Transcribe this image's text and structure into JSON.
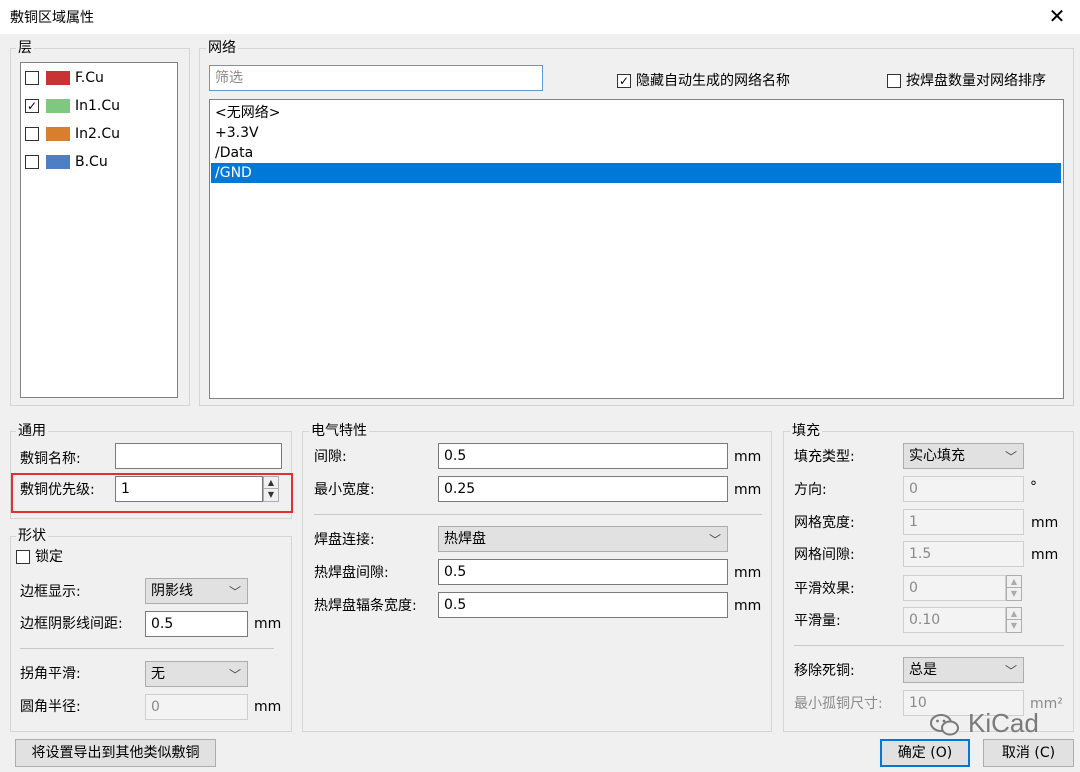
{
  "window": {
    "title": "敷铜区域属性",
    "close_glyph": "✕"
  },
  "layers": {
    "group_label": "层",
    "items": [
      {
        "name": "F.Cu",
        "checked": false,
        "color": "#c83434"
      },
      {
        "name": "In1.Cu",
        "checked": true,
        "color": "#7fc87f"
      },
      {
        "name": "In2.Cu",
        "checked": false,
        "color": "#d87f2e"
      },
      {
        "name": "B.Cu",
        "checked": false,
        "color": "#4d7fc4"
      }
    ]
  },
  "nets": {
    "group_label": "网络",
    "filter_placeholder": "筛选",
    "hide_auto_label": "隐藏自动生成的网络名称",
    "hide_auto_checked": true,
    "sort_by_pads_label": "按焊盘数量对网络排序",
    "sort_by_pads_checked": false,
    "items": [
      "<无网络>",
      "+3.3V",
      "/Data",
      "/GND"
    ],
    "selected_index": 3
  },
  "general": {
    "group_label": "通用",
    "name_label": "敷铜名称:",
    "name_value": "",
    "priority_label": "敷铜优先级:",
    "priority_value": "1"
  },
  "shape": {
    "group_label": "形状",
    "lock_label": "锁定",
    "lock_checked": false,
    "outline_display_label": "边框显示:",
    "outline_display_value": "阴影线",
    "hatch_pitch_label": "边框阴影线间距:",
    "hatch_pitch_value": "0.5",
    "hatch_pitch_unit": "mm",
    "corner_smoothing_label": "拐角平滑:",
    "corner_smoothing_value": "无",
    "fillet_radius_label": "圆角半径:",
    "fillet_radius_value": "0",
    "fillet_radius_unit": "mm"
  },
  "electrical": {
    "group_label": "电气特性",
    "clearance_label": "间隙:",
    "clearance_value": "0.5",
    "clearance_unit": "mm",
    "min_width_label": "最小宽度:",
    "min_width_value": "0.25",
    "min_width_unit": "mm",
    "pad_connection_label": "焊盘连接:",
    "pad_connection_value": "热焊盘",
    "thermal_gap_label": "热焊盘间隙:",
    "thermal_gap_value": "0.5",
    "thermal_gap_unit": "mm",
    "spoke_width_label": "热焊盘辐条宽度:",
    "spoke_width_value": "0.5",
    "spoke_width_unit": "mm"
  },
  "fill": {
    "group_label": "填充",
    "fill_type_label": "填充类型:",
    "fill_type_value": "实心填充",
    "orientation_label": "方向:",
    "orientation_value": "0",
    "orientation_unit": "°",
    "hatch_width_label": "网格宽度:",
    "hatch_width_value": "1",
    "hatch_width_unit": "mm",
    "hatch_gap_label": "网格间隙:",
    "hatch_gap_value": "1.5",
    "hatch_gap_unit": "mm",
    "smoothing_effort_label": "平滑效果:",
    "smoothing_effort_value": "0",
    "smoothing_amount_label": "平滑量:",
    "smoothing_amount_value": "0.10",
    "remove_islands_label": "移除死铜:",
    "remove_islands_value": "总是",
    "min_island_label": "最小孤铜尺寸:",
    "min_island_value": "10",
    "min_island_unit": "mm²"
  },
  "footer": {
    "export_label": "将设置导出到其他类似敷铜",
    "ok_label": "确定 (O)",
    "cancel_label": "取消 (C)",
    "watermark_text": "KiCad"
  },
  "colors": {
    "selection": "#0078d7",
    "highlight_box": "#e03030"
  }
}
